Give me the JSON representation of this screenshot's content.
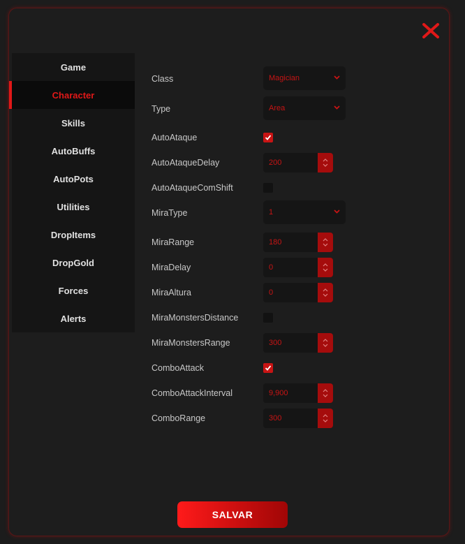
{
  "sidebar": {
    "items": [
      {
        "label": "Game"
      },
      {
        "label": "Character"
      },
      {
        "label": "Skills"
      },
      {
        "label": "AutoBuffs"
      },
      {
        "label": "AutoPots"
      },
      {
        "label": "Utilities"
      },
      {
        "label": "DropItems"
      },
      {
        "label": "DropGold"
      },
      {
        "label": "Forces"
      },
      {
        "label": "Alerts"
      }
    ],
    "active": "Character"
  },
  "settings": {
    "class": {
      "label": "Class",
      "value": "Magician"
    },
    "type": {
      "label": "Type",
      "value": "Area"
    },
    "auto_ataque": {
      "label": "AutoAtaque",
      "checked": true
    },
    "auto_ataque_delay": {
      "label": "AutoAtaqueDelay",
      "value": "200"
    },
    "auto_ataque_com_shift": {
      "label": "AutoAtaqueComShift",
      "checked": false
    },
    "mira_type": {
      "label": "MiraType",
      "value": "1"
    },
    "mira_range": {
      "label": "MiraRange",
      "value": "180"
    },
    "mira_delay": {
      "label": "MiraDelay",
      "value": "0"
    },
    "mira_altura": {
      "label": "MiraAltura",
      "value": "0"
    },
    "mira_monsters_distance": {
      "label": "MiraMonstersDistance",
      "checked": false
    },
    "mira_monsters_range": {
      "label": "MiraMonstersRange",
      "value": "300"
    },
    "combo_attack": {
      "label": "ComboAttack",
      "checked": true
    },
    "combo_attack_interval": {
      "label": "ComboAttackInterval",
      "value": "9,900"
    },
    "combo_range": {
      "label": "ComboRange",
      "value": "300"
    }
  },
  "footer": {
    "save_label": "SALVAR"
  },
  "colors": {
    "accent": "#e01818",
    "background": "#1d1d1d",
    "sidebar": "#151515",
    "field": "#151515"
  }
}
